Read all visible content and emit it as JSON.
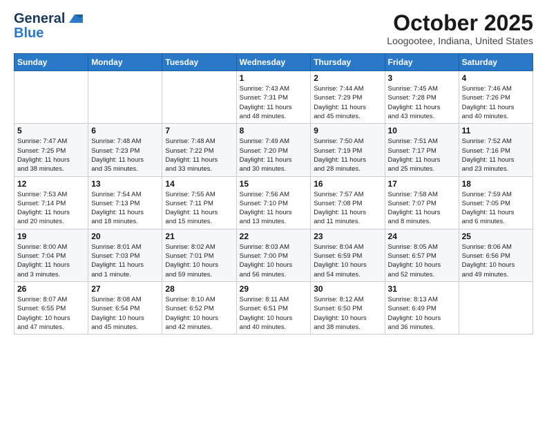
{
  "logo": {
    "line1": "General",
    "line2": "Blue"
  },
  "title": "October 2025",
  "location": "Loogootee, Indiana, United States",
  "days_header": [
    "Sunday",
    "Monday",
    "Tuesday",
    "Wednesday",
    "Thursday",
    "Friday",
    "Saturday"
  ],
  "weeks": [
    [
      {
        "day": "",
        "info": ""
      },
      {
        "day": "",
        "info": ""
      },
      {
        "day": "",
        "info": ""
      },
      {
        "day": "1",
        "info": "Sunrise: 7:43 AM\nSunset: 7:31 PM\nDaylight: 11 hours\nand 48 minutes."
      },
      {
        "day": "2",
        "info": "Sunrise: 7:44 AM\nSunset: 7:29 PM\nDaylight: 11 hours\nand 45 minutes."
      },
      {
        "day": "3",
        "info": "Sunrise: 7:45 AM\nSunset: 7:28 PM\nDaylight: 11 hours\nand 43 minutes."
      },
      {
        "day": "4",
        "info": "Sunrise: 7:46 AM\nSunset: 7:26 PM\nDaylight: 11 hours\nand 40 minutes."
      }
    ],
    [
      {
        "day": "5",
        "info": "Sunrise: 7:47 AM\nSunset: 7:25 PM\nDaylight: 11 hours\nand 38 minutes."
      },
      {
        "day": "6",
        "info": "Sunrise: 7:48 AM\nSunset: 7:23 PM\nDaylight: 11 hours\nand 35 minutes."
      },
      {
        "day": "7",
        "info": "Sunrise: 7:48 AM\nSunset: 7:22 PM\nDaylight: 11 hours\nand 33 minutes."
      },
      {
        "day": "8",
        "info": "Sunrise: 7:49 AM\nSunset: 7:20 PM\nDaylight: 11 hours\nand 30 minutes."
      },
      {
        "day": "9",
        "info": "Sunrise: 7:50 AM\nSunset: 7:19 PM\nDaylight: 11 hours\nand 28 minutes."
      },
      {
        "day": "10",
        "info": "Sunrise: 7:51 AM\nSunset: 7:17 PM\nDaylight: 11 hours\nand 25 minutes."
      },
      {
        "day": "11",
        "info": "Sunrise: 7:52 AM\nSunset: 7:16 PM\nDaylight: 11 hours\nand 23 minutes."
      }
    ],
    [
      {
        "day": "12",
        "info": "Sunrise: 7:53 AM\nSunset: 7:14 PM\nDaylight: 11 hours\nand 20 minutes."
      },
      {
        "day": "13",
        "info": "Sunrise: 7:54 AM\nSunset: 7:13 PM\nDaylight: 11 hours\nand 18 minutes."
      },
      {
        "day": "14",
        "info": "Sunrise: 7:55 AM\nSunset: 7:11 PM\nDaylight: 11 hours\nand 15 minutes."
      },
      {
        "day": "15",
        "info": "Sunrise: 7:56 AM\nSunset: 7:10 PM\nDaylight: 11 hours\nand 13 minutes."
      },
      {
        "day": "16",
        "info": "Sunrise: 7:57 AM\nSunset: 7:08 PM\nDaylight: 11 hours\nand 11 minutes."
      },
      {
        "day": "17",
        "info": "Sunrise: 7:58 AM\nSunset: 7:07 PM\nDaylight: 11 hours\nand 8 minutes."
      },
      {
        "day": "18",
        "info": "Sunrise: 7:59 AM\nSunset: 7:05 PM\nDaylight: 11 hours\nand 6 minutes."
      }
    ],
    [
      {
        "day": "19",
        "info": "Sunrise: 8:00 AM\nSunset: 7:04 PM\nDaylight: 11 hours\nand 3 minutes."
      },
      {
        "day": "20",
        "info": "Sunrise: 8:01 AM\nSunset: 7:03 PM\nDaylight: 11 hours\nand 1 minute."
      },
      {
        "day": "21",
        "info": "Sunrise: 8:02 AM\nSunset: 7:01 PM\nDaylight: 10 hours\nand 59 minutes."
      },
      {
        "day": "22",
        "info": "Sunrise: 8:03 AM\nSunset: 7:00 PM\nDaylight: 10 hours\nand 56 minutes."
      },
      {
        "day": "23",
        "info": "Sunrise: 8:04 AM\nSunset: 6:59 PM\nDaylight: 10 hours\nand 54 minutes."
      },
      {
        "day": "24",
        "info": "Sunrise: 8:05 AM\nSunset: 6:57 PM\nDaylight: 10 hours\nand 52 minutes."
      },
      {
        "day": "25",
        "info": "Sunrise: 8:06 AM\nSunset: 6:56 PM\nDaylight: 10 hours\nand 49 minutes."
      }
    ],
    [
      {
        "day": "26",
        "info": "Sunrise: 8:07 AM\nSunset: 6:55 PM\nDaylight: 10 hours\nand 47 minutes."
      },
      {
        "day": "27",
        "info": "Sunrise: 8:08 AM\nSunset: 6:54 PM\nDaylight: 10 hours\nand 45 minutes."
      },
      {
        "day": "28",
        "info": "Sunrise: 8:10 AM\nSunset: 6:52 PM\nDaylight: 10 hours\nand 42 minutes."
      },
      {
        "day": "29",
        "info": "Sunrise: 8:11 AM\nSunset: 6:51 PM\nDaylight: 10 hours\nand 40 minutes."
      },
      {
        "day": "30",
        "info": "Sunrise: 8:12 AM\nSunset: 6:50 PM\nDaylight: 10 hours\nand 38 minutes."
      },
      {
        "day": "31",
        "info": "Sunrise: 8:13 AM\nSunset: 6:49 PM\nDaylight: 10 hours\nand 36 minutes."
      },
      {
        "day": "",
        "info": ""
      }
    ]
  ]
}
